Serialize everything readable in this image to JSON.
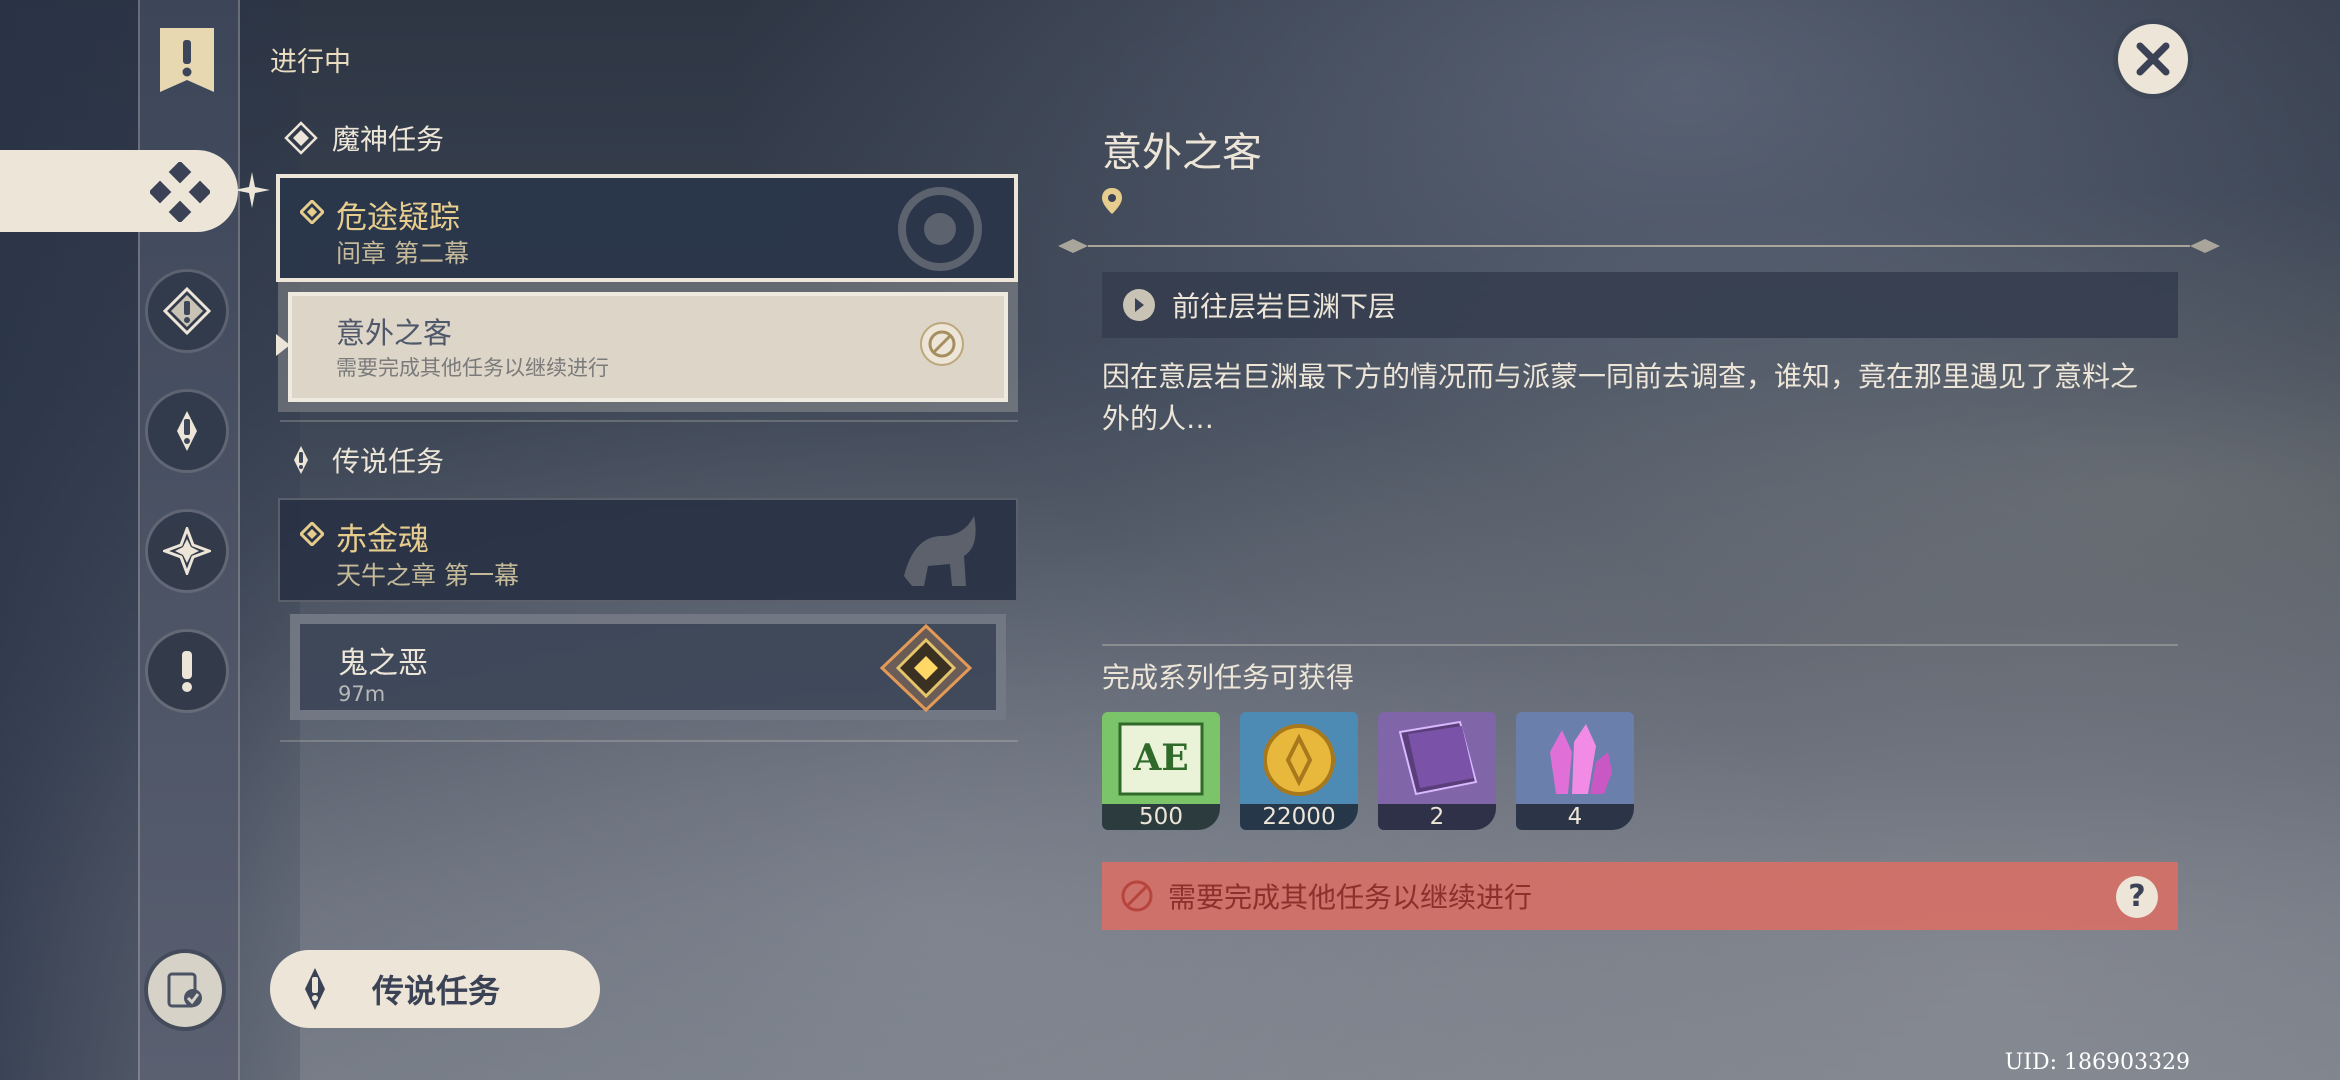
{
  "header": {
    "status_label": "进行中"
  },
  "sections": [
    {
      "label": "魔神任务",
      "quest": {
        "title": "危途疑踪",
        "subtitle": "间章 第二幕"
      },
      "sub": {
        "title": "意外之客",
        "status": "需要完成其他任务以继续进行"
      }
    },
    {
      "label": "传说任务",
      "quest": {
        "title": "赤金魂",
        "subtitle": "天牛之章 第一幕"
      },
      "sub": {
        "title": "鬼之恶",
        "distance": "97m"
      }
    }
  ],
  "bottom_button": {
    "label": "传说任务"
  },
  "detail": {
    "title": "意外之客",
    "objective": "前往层岩巨渊下层",
    "description": "因在意层岩巨渊最下方的情况而与派蒙一同前去调查，谁知，竟在那里遇见了意料之外的人…",
    "rewards_heading": "完成系列任务可获得",
    "rewards": [
      {
        "icon": "adventure-exp-icon",
        "count": "500"
      },
      {
        "icon": "mora-icon",
        "count": "22000"
      },
      {
        "icon": "heros-wit-icon",
        "count": "2"
      },
      {
        "icon": "crystal-icon",
        "count": "4"
      }
    ],
    "blocked_message": "需要完成其他任务以继续进行",
    "help_glyph": "?"
  },
  "uid": "UID: 186903329",
  "colors": {
    "accent_gold": "#e6cd8e",
    "panel_light": "#ece5d8",
    "warning_red": "#dc6e64"
  }
}
